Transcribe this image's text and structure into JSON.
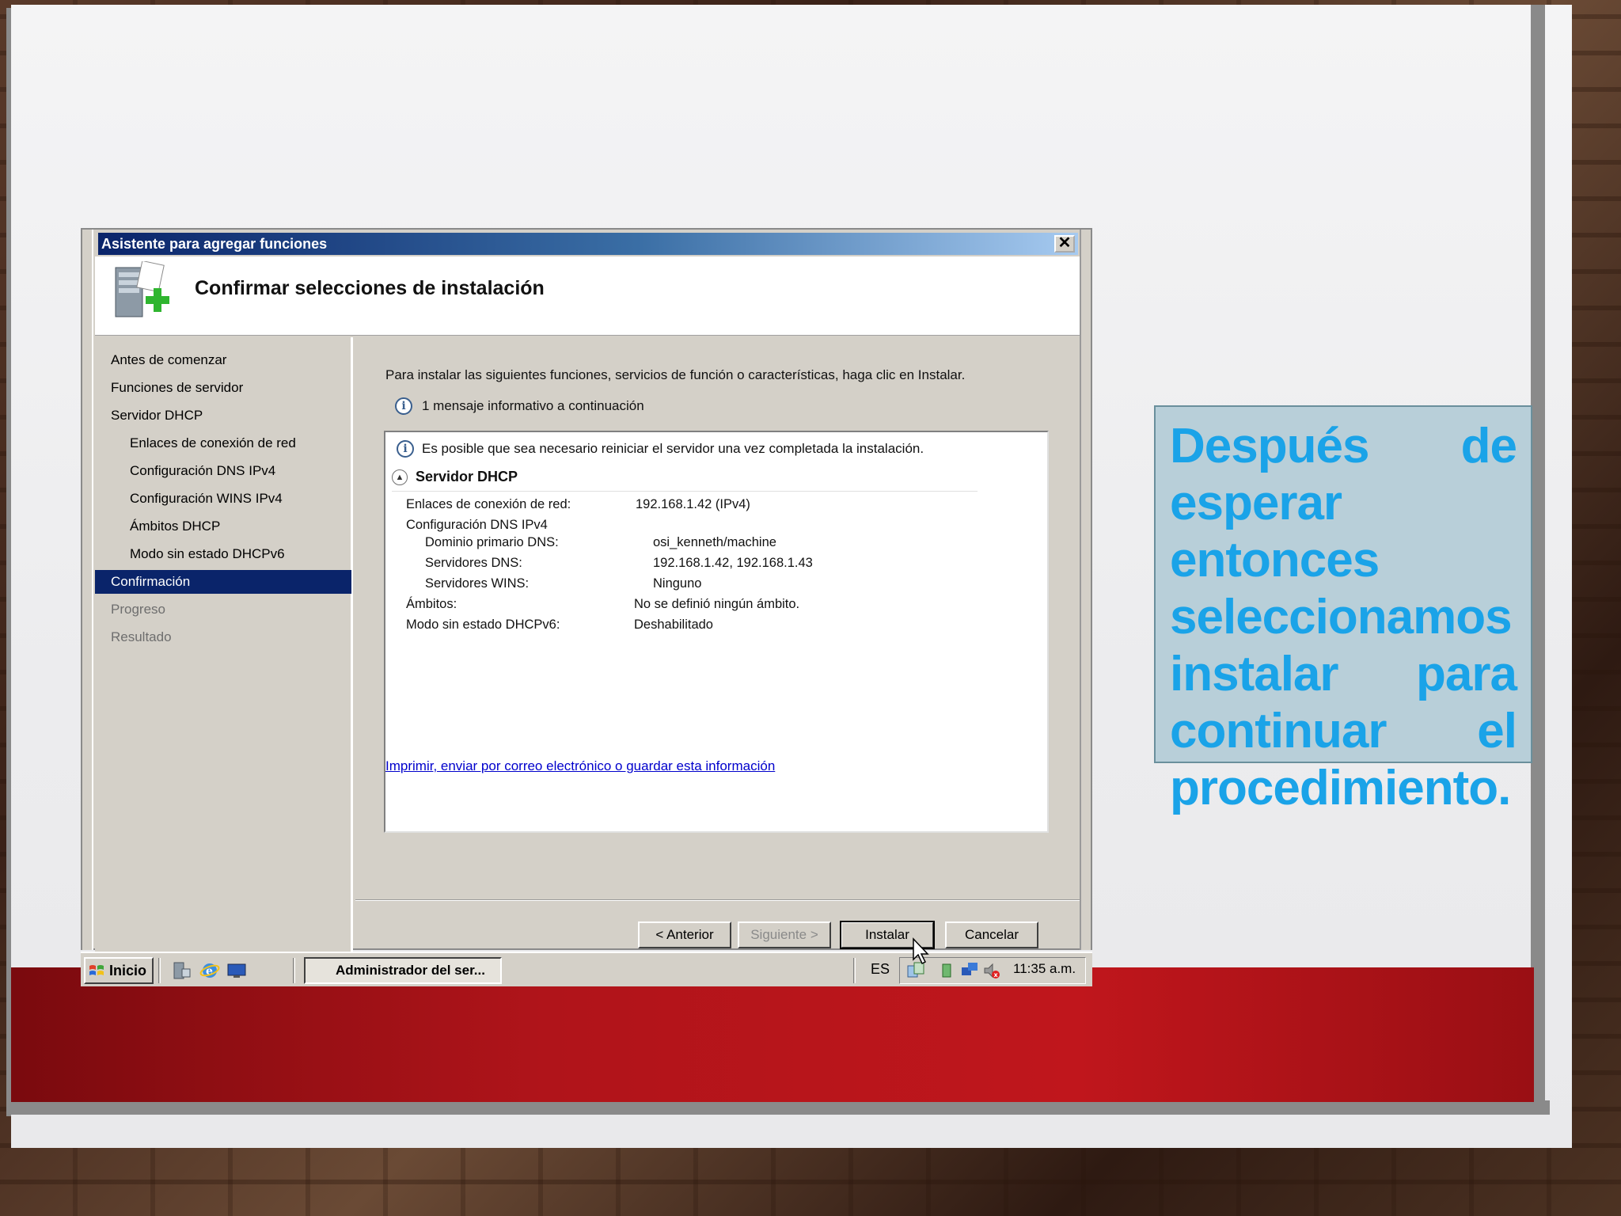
{
  "window": {
    "title": "Asistente para agregar funciones",
    "close_label": "✕",
    "header_title": "Confirmar selecciones de instalación"
  },
  "nav": {
    "items": [
      {
        "label": "Antes de comenzar",
        "state": "normal"
      },
      {
        "label": "Funciones de servidor",
        "state": "normal"
      },
      {
        "label": "Servidor DHCP",
        "state": "normal"
      },
      {
        "label": "Enlaces de conexión de red",
        "state": "sub"
      },
      {
        "label": "Configuración DNS IPv4",
        "state": "sub"
      },
      {
        "label": "Configuración WINS IPv4",
        "state": "sub"
      },
      {
        "label": "Ámbitos DHCP",
        "state": "sub"
      },
      {
        "label": "Modo sin estado DHCPv6",
        "state": "sub"
      },
      {
        "label": "Confirmación",
        "state": "active"
      },
      {
        "label": "Progreso",
        "state": "disabled"
      },
      {
        "label": "Resultado",
        "state": "disabled"
      }
    ]
  },
  "content": {
    "intro": "Para instalar las siguientes funciones, servicios de función o características, haga clic en Instalar.",
    "info_message": "1 mensaje informativo a continuación",
    "warning": "Es posible que sea necesario reiniciar el servidor una vez completada la instalación.",
    "section_title": "Servidor DHCP",
    "rows": {
      "enlaces_label": "Enlaces de conexión de red:",
      "enlaces_value": "192.168.1.42 (IPv4)",
      "dns_config_label": "Configuración DNS IPv4",
      "dominio_label": "Dominio primario DNS:",
      "dominio_value": "osi_kenneth/machine",
      "dns_servers_label": "Servidores DNS:",
      "dns_servers_value": "192.168.1.42, 192.168.1.43",
      "wins_label": "Servidores WINS:",
      "wins_value": "Ninguno",
      "ambitos_label": "Ámbitos:",
      "ambitos_value": "No se definió ningún ámbito.",
      "modo_label": "Modo sin estado DHCPv6:",
      "modo_value": "Deshabilitado"
    },
    "link": "Imprimir, enviar por correo electrónico o guardar esta información"
  },
  "buttons": {
    "back": "< Anterior",
    "next": "Siguiente >",
    "install": "Instalar",
    "cancel": "Cancelar"
  },
  "taskbar": {
    "start": "Inicio",
    "task": "Administrador del ser...",
    "lang": "ES",
    "clock": "11:35 a.m."
  },
  "caption": {
    "text": "Después de esperar entonces seleccionamos instalar para continuar el procedimiento."
  },
  "colors": {
    "title_bar": "#0a246a",
    "nav_active": "#0a246a",
    "caption_text": "#1aa3e8",
    "caption_bg": "#b8cfd9",
    "red_band": "#b0141a"
  }
}
